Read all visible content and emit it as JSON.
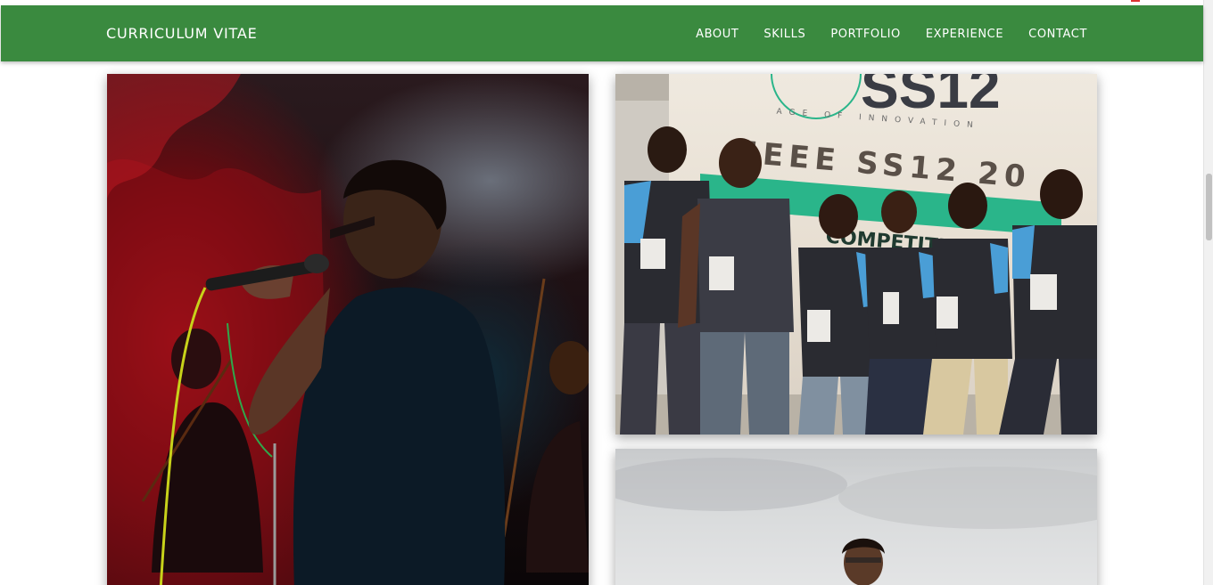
{
  "header": {
    "brand": "CURRICULUM VITAE",
    "nav": [
      "ABOUT",
      "SKILLS",
      "PORTFOLIO",
      "EXPERIENCE",
      "CONTACT"
    ]
  },
  "gallery": {
    "photos": [
      {
        "name": "singer-photo",
        "text": ""
      },
      {
        "name": "group-photo",
        "banner_logo_text": "SS12",
        "banner_tagline": "AGE OF INNOVATION",
        "banner_event": "IEEE SS12 20",
        "banner_sub": "COMPETITION &"
      },
      {
        "name": "outdoor-photo",
        "text": ""
      }
    ]
  },
  "colors": {
    "navbar": "#3a8a3f",
    "banner_green": "#2ab58a",
    "polo_dark": "#2a2b31",
    "polo_accent": "#4a9ed6"
  }
}
